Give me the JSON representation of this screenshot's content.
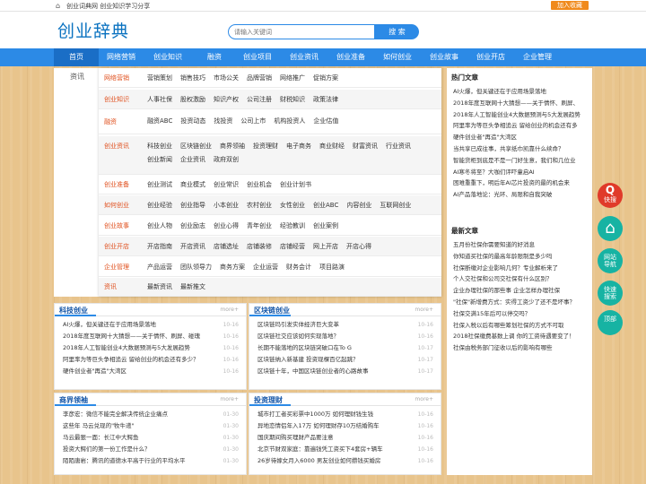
{
  "topbar": {
    "home_icon": "home-icon",
    "title": "创业词典网 创业知识学习分享",
    "fav": "加入收藏"
  },
  "header": {
    "logo": "创业辞典",
    "search_placeholder": "请输入关键词",
    "search_button": "搜 索"
  },
  "nav": [
    "首页",
    "网络营销",
    "创业知识",
    "融资",
    "创业项目",
    "创业资讯",
    "创业准备",
    "如何创业",
    "创业故事",
    "创业开店",
    "企业管理"
  ],
  "sub_label": "资讯",
  "mega": [
    {
      "cat": "网络营销",
      "items": [
        "营销策划",
        "销售技巧",
        "市场公关",
        "品牌营销",
        "网络推广",
        "促销方案"
      ]
    },
    {
      "cat": "创业知识",
      "items": [
        "人事社保",
        "股权激励",
        "知识产权",
        "公司注册",
        "财税知识",
        "政策法律"
      ]
    },
    {
      "cat": "融资",
      "items": [
        "融资ABC",
        "投资动态",
        "找投资",
        "公司上市",
        "机构投资人",
        "企业估值"
      ]
    },
    {
      "cat": "创业资讯",
      "items": [
        "科技创业",
        "区块链创业",
        "商界领袖",
        "投资理财",
        "电子商务",
        "商业财经",
        "财富资讯",
        "行业资讯",
        "创业新闻",
        "企业资讯",
        "政府双创"
      ]
    },
    {
      "cat": "创业准备",
      "items": [
        "创业测试",
        "商业模式",
        "创业常识",
        "创业机会",
        "创业计划书"
      ]
    },
    {
      "cat": "如何创业",
      "items": [
        "创业经验",
        "创业指导",
        "小本创业",
        "农村创业",
        "女性创业",
        "创业ABC",
        "内容创业",
        "互联网创业"
      ]
    },
    {
      "cat": "创业故事",
      "items": [
        "创业人物",
        "创业励志",
        "创业心得",
        "青年创业",
        "经验教训",
        "创业案例"
      ]
    },
    {
      "cat": "创业开店",
      "items": [
        "开店指南",
        "开店资讯",
        "店铺选址",
        "店铺装修",
        "店铺经营",
        "网上开店",
        "开店心得"
      ]
    },
    {
      "cat": "企业管理",
      "items": [
        "产品运营",
        "团队领导力",
        "商务方案",
        "企业运营",
        "财务会计",
        "项目路演"
      ]
    },
    {
      "cat": "资讯",
      "items": [
        "最新资讯",
        "最新推文"
      ]
    }
  ],
  "panels": [
    {
      "title": "科技创业",
      "more": "more+",
      "items": [
        [
          "AI火爆，但关键还在于应用场景落地",
          "10-16"
        ],
        [
          "2018年度互联网十大猜想——关于情怀、刷屏、碰瑰",
          "10-16"
        ],
        [
          "2018年人工智能创业4大数据预测与5大发展趋势",
          "10-16"
        ],
        [
          "阿里率为等巨头争相追云 留给创业的机会还有多少？",
          "10-16"
        ],
        [
          "硬件创业者\"再造\"大湾区",
          "10-16"
        ]
      ]
    },
    {
      "title": "区块链创业",
      "more": "more+",
      "items": [
        [
          "区块链玛引发实体经济巨大变革",
          "10-16"
        ],
        [
          "区块链社交应该如何实现落地？",
          "10-16"
        ],
        [
          "长期不能落地的区块链突破口在To G",
          "10-17"
        ],
        [
          "区块链纳入新基建 投资现棵百亿起跳？",
          "10-17"
        ],
        [
          "区块链十年，中国区块链创业者的心路故事",
          "10-17"
        ]
      ]
    },
    {
      "title": "商界领袖",
      "more": "more+",
      "items": [
        [
          "李彦宏：微信不能完全解决传统企业痛点",
          "01-30"
        ],
        [
          "这些年 马云兑现的\"牧牛递\"",
          "01-30"
        ],
        [
          "马云最狠一面：长江中大鳄鱼",
          "01-30"
        ],
        [
          "投资大鳄们的第一份工作是什么？",
          "01-30"
        ],
        [
          "陌陌唐岩：腾讯的道德水平高于行业的平均水平",
          "01-30"
        ]
      ]
    },
    {
      "title": "投资理财",
      "more": "more+",
      "items": [
        [
          "城市打工者买彩票中1000万 如何理财钱生钱",
          "10-16"
        ],
        [
          "异地恋情侣年入17万 如何理财存10万结婚购车",
          "10-16"
        ],
        [
          "国庆期间购买理财产品要注意",
          "10-16"
        ],
        [
          "北京节财双家庭：靠遍钱凭工资买下4套房+辆车",
          "10-16"
        ],
        [
          "26岁待嫁女月入6000 男友创业如何攒钱买婚房",
          "10-16"
        ]
      ]
    }
  ],
  "sidebar": {
    "hot_title": "热门文章",
    "hot": [
      "AI火爆，但关键还在于应用场景落地",
      "2018年度互联网十大猜想——关于情怀、刷屏、",
      "2018年人工智能创业4大数据预测与5大发展趋势",
      "阿里率为等巨头争相追云 留给创业的机会还有多",
      "硬件创业者\"再造\"大湾区",
      "当共享已成往事，共享纸巾凯靠什么续命？",
      "智能货柜到底是不是一门好生意，我们和几位业",
      "AI寒冬将至？大咖们评吓童启AI",
      "困难重重下，明后年AI芯片投资的最的机会来",
      "AI产品落地论：光环、局限和自我突破"
    ],
    "new_title": "最新文章",
    "new": [
      "五月份社保你需要知道的好消息",
      "你知道买社保的最高年龄限制是多少吗",
      "社保断缴对企业影响几何？专业解析来了",
      "个人交社保和公司交社保有什么区别？",
      "企业办理社保的那些事 企业怎样办理社保",
      "\"社保\"新增费方式：实得工资少了还不是坏事？",
      "社保交满15年后可以停交吗？",
      "社保入税以后有哪些筹划社保的方式不可取",
      "2018社保缴费基数上调 你的工资待遇要变了！",
      "社保由税务部门征收以后的影响有哪些"
    ]
  },
  "float": [
    {
      "icon": "q-icon",
      "label": "快搜"
    },
    {
      "icon": "home-icon",
      "label": ""
    },
    {
      "icon": "",
      "label": "网站导航"
    },
    {
      "icon": "",
      "label": "快速搜索"
    },
    {
      "icon": "",
      "label": "顶部"
    }
  ],
  "colors": {
    "nav": "#2c8ae6",
    "accent": "#e0501e",
    "fav": "#f08a1c"
  }
}
